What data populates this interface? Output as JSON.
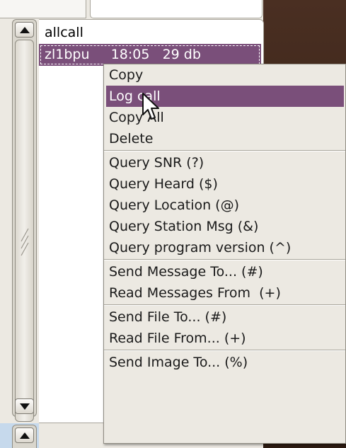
{
  "list": {
    "rows": [
      {
        "text": "allcall",
        "selected": false
      },
      {
        "text": "zl1bpu     18:05   29 db",
        "selected": true
      }
    ]
  },
  "context_menu": {
    "items": [
      {
        "label": "Copy",
        "active": false
      },
      {
        "label": "Log call",
        "active": true
      },
      {
        "label": "Copy All",
        "active": false
      },
      {
        "label": "Delete",
        "active": false
      },
      {
        "label": "Query SNR (?)",
        "active": false
      },
      {
        "label": "Query Heard ($)",
        "active": false
      },
      {
        "label": "Query Location (@)",
        "active": false
      },
      {
        "label": "Query Station Msg (&)",
        "active": false
      },
      {
        "label": "Query program version (^)",
        "active": false
      },
      {
        "label": "Send Message To... (#)",
        "active": false
      },
      {
        "label": "Read Messages From  (+)",
        "active": false
      },
      {
        "label": "Send File To... (#)",
        "active": false
      },
      {
        "label": "Read File From... (+)",
        "active": false
      },
      {
        "label": "Send Image To... (%)",
        "active": false
      }
    ]
  },
  "icons": {
    "scroll_up": "chevron-up-icon",
    "scroll_down": "chevron-down-icon",
    "grip": "scroll-grip-icon",
    "cursor": "mouse-pointer-icon"
  },
  "colors": {
    "selection": "#7a4f7a",
    "menu_bg": "#ece9e2",
    "list_bg": "#ffffff",
    "bg_window": "#3a2418"
  }
}
